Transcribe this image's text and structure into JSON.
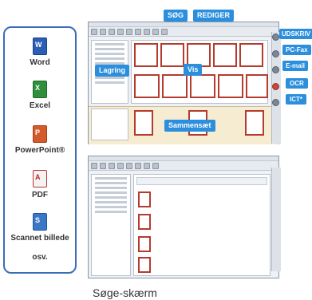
{
  "left_panel": {
    "items": [
      {
        "label": "Word",
        "icon": "word-icon"
      },
      {
        "label": "Excel",
        "icon": "excel-icon"
      },
      {
        "label": "PowerPoint®",
        "icon": "powerpoint-icon"
      },
      {
        "label": "PDF",
        "icon": "pdf-icon"
      },
      {
        "label": "Scannet billede",
        "icon": "scanned-image-icon"
      },
      {
        "label": "osv.",
        "icon": ""
      }
    ]
  },
  "top_callouts": {
    "search": "SØG",
    "edit": "REDIGER"
  },
  "right_callouts": {
    "print": "UDSKRIV",
    "pcfax": "PC-Fax",
    "email": "E-mail",
    "ocr": "OCR",
    "ict": "ICT*"
  },
  "in_window_callouts": {
    "storage": "Lagring",
    "view": "Vis",
    "merge": "Sammensæt"
  },
  "caption": "Søge-skærm",
  "colors": {
    "callout_blue": "#2b8fdd",
    "panel_border": "#3b6db6",
    "accent_red": "#c53b34"
  }
}
